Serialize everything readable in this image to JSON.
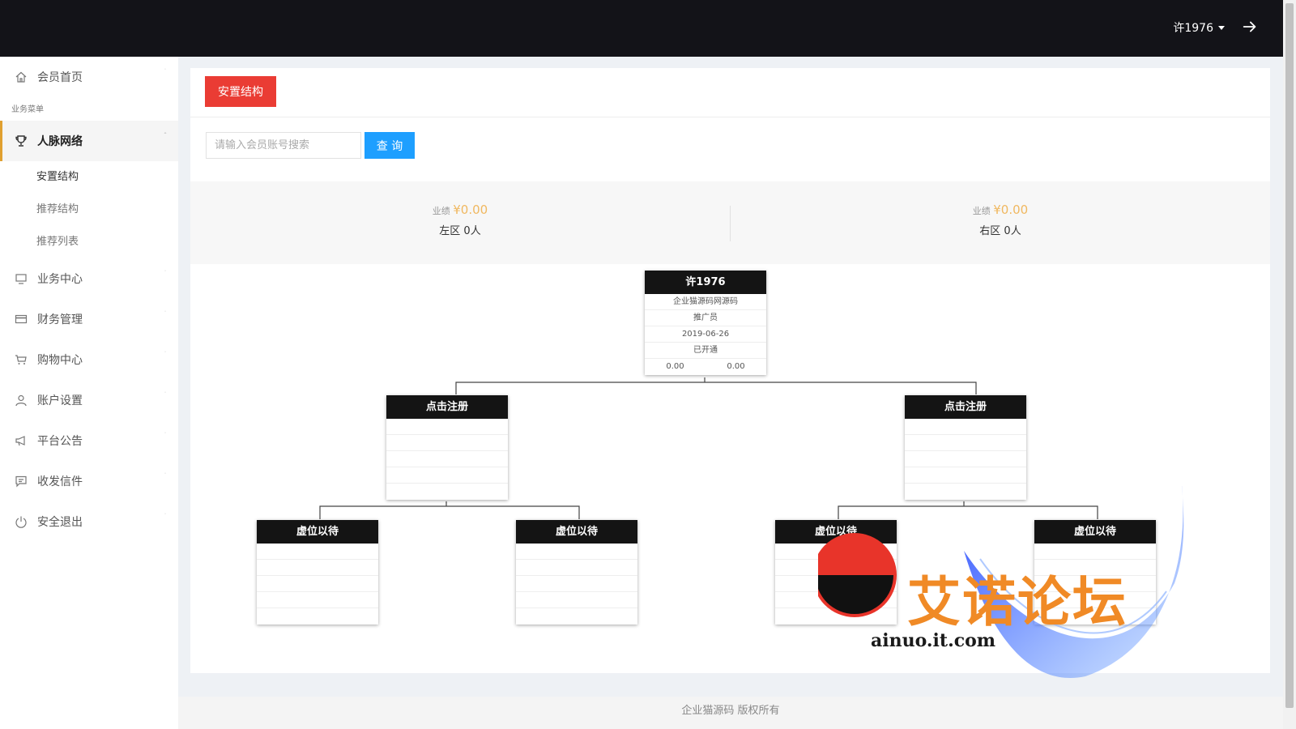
{
  "header": {
    "username": "许1976"
  },
  "sidebar": {
    "home": "会员首页",
    "section_label": "业务菜单",
    "network": {
      "label": "人脉网络",
      "children": [
        "安置结构",
        "推荐结构",
        "推荐列表"
      ]
    },
    "items": [
      {
        "label": "业务中心",
        "icon": "monitor-icon"
      },
      {
        "label": "财务管理",
        "icon": "card-icon"
      },
      {
        "label": "购物中心",
        "icon": "cart-icon"
      },
      {
        "label": "账户设置",
        "icon": "user-icon"
      },
      {
        "label": "平台公告",
        "icon": "megaphone-icon"
      },
      {
        "label": "收发信件",
        "icon": "message-icon"
      },
      {
        "label": "安全退出",
        "icon": "power-icon"
      }
    ]
  },
  "main": {
    "tab_label": "安置结构",
    "search": {
      "placeholder": "请输入会员账号搜索",
      "value": "",
      "button": "查 询"
    },
    "stats": {
      "perf_label": "业绩",
      "left": {
        "amount": "¥0.00",
        "zone": "左区 0人"
      },
      "right": {
        "amount": "¥0.00",
        "zone": "右区 0人"
      }
    },
    "tree": {
      "root": {
        "title": "许1976",
        "rows": [
          "企业猫源码网源码",
          "推广员",
          "2019-06-26",
          "已开通"
        ],
        "left_value": "0.00",
        "right_value": "0.00"
      },
      "level2": [
        {
          "title": "点击注册"
        },
        {
          "title": "点击注册"
        }
      ],
      "level3": [
        {
          "title": "虚位以待"
        },
        {
          "title": "虚位以待"
        },
        {
          "title": "虚位以待"
        },
        {
          "title": "虚位以待"
        }
      ]
    }
  },
  "watermark": {
    "text": "艾诺论坛",
    "url": "ainuo.it.com"
  },
  "footer": {
    "text": "企业猫源码 版权所有"
  },
  "colors": {
    "topbar": "#131318",
    "accent_red": "#ea3c34",
    "accent_blue": "#1e9fff",
    "money": "#f0b860",
    "active_border": "#e0a030"
  }
}
